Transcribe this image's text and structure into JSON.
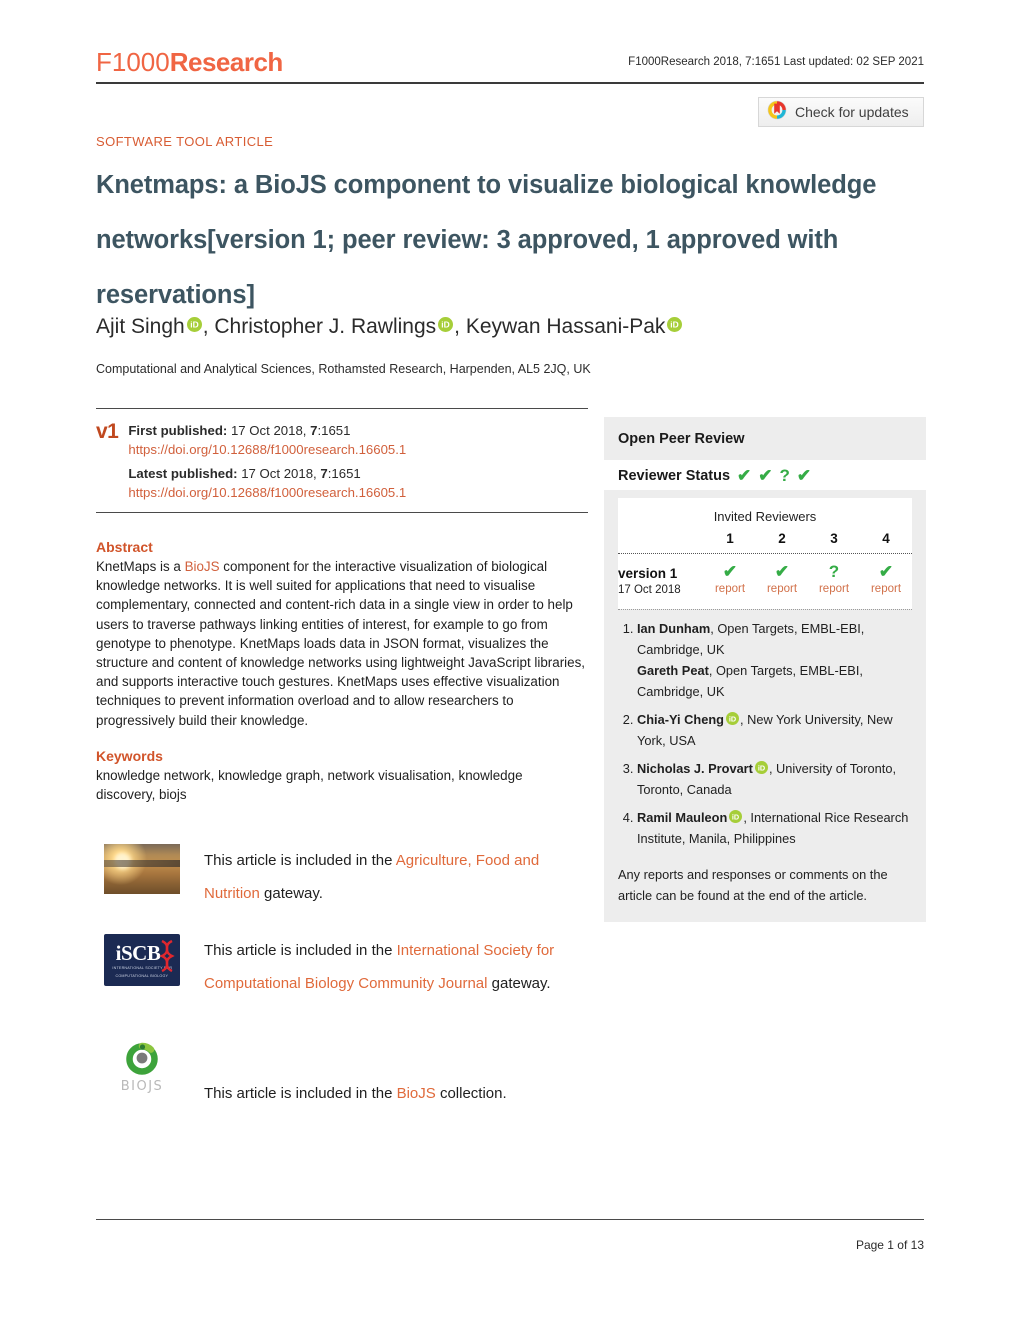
{
  "header": {
    "logo_part1": "F1000",
    "logo_part2": "Research",
    "citation": "F1000Research 2018, 7:1651 Last updated: 02 SEP 2021",
    "crossmark_label": "Check for updates",
    "crossmark_icon": "crossmark-icon"
  },
  "article": {
    "type": "SOFTWARE TOOL ARTICLE",
    "title_main": "Knetmaps: a BioJS component to visualize biological knowledge networks",
    "title_bracket": "[version 1; peer review: 3 approved, 1 approved with reservations]",
    "authors": [
      {
        "name": "Ajit Singh",
        "orcid": true
      },
      {
        "name": "Christopher J. Rawlings",
        "orcid": true
      },
      {
        "name": "Keywan Hassani-Pak",
        "orcid": true
      }
    ],
    "affiliation": "Computational and Analytical Sciences, Rothamsted Research, Harpenden, AL5 2JQ, UK"
  },
  "publication": {
    "version_badge": "v1",
    "first_published_label": "First published:",
    "first_published_date": "17 Oct 2018, ",
    "first_published_vol": "7",
    "first_published_issue": ":1651",
    "first_doi": "https://doi.org/10.12688/f1000research.16605.1",
    "latest_published_label": "Latest published:",
    "latest_published_date": "17 Oct 2018, ",
    "latest_published_vol": "7",
    "latest_published_issue": ":1651",
    "latest_doi": "https://doi.org/10.12688/f1000research.16605.1"
  },
  "abstract": {
    "heading": "Abstract",
    "text_1": "KnetMaps is a ",
    "link": "BioJS",
    "text_2": " component for the interactive visualization of biological knowledge networks. It is well suited for applications that need to visualise complementary, connected and content-rich data in a single view in order to help users to traverse pathways linking entities of interest, for example to go from genotype to phenotype. KnetMaps loads data in JSON format, visualizes the structure and content of knowledge networks using lightweight JavaScript libraries, and supports interactive touch gestures. KnetMaps uses effective visualization techniques to prevent information overload and to allow researchers to progressively build their knowledge."
  },
  "keywords": {
    "heading": "Keywords",
    "text": "knowledge network, knowledge graph, network visualisation, knowledge discovery, biojs"
  },
  "gateways": [
    {
      "icon": "sunset-field-thumbnail",
      "prefix": "This article is included in the ",
      "link": "Agriculture, Food and Nutrition",
      "suffix": " gateway."
    },
    {
      "icon": "iscb-logo",
      "prefix": "This article is included in the ",
      "link": "International Society for Computational Biology Community Journal",
      "suffix": " gateway."
    },
    {
      "icon": "biojs-logo",
      "prefix": "This article is included in the ",
      "link": "BioJS",
      "suffix": " collection."
    }
  ],
  "iscb_logo": {
    "word": "iSCB",
    "subtitle_line1": "INTERNATIONAL SOCIETY FOR",
    "subtitle_line2": "COMPUTATIONAL BIOLOGY"
  },
  "biojs_logo": {
    "word": "BIOJS"
  },
  "peer_review": {
    "panel_title": "Open Peer Review",
    "status_label": "Reviewer Status",
    "status_marks": [
      "check",
      "check",
      "question",
      "check"
    ],
    "invited_reviewers_label": "Invited Reviewers",
    "columns": [
      "1",
      "2",
      "3",
      "4"
    ],
    "version_row": {
      "name": "version 1",
      "date": "17 Oct 2018",
      "cells": [
        {
          "mark": "check",
          "report": "report"
        },
        {
          "mark": "check",
          "report": "report"
        },
        {
          "mark": "question",
          "report": "report"
        },
        {
          "mark": "check",
          "report": "report"
        }
      ]
    },
    "reviewers": [
      {
        "index": "1.",
        "lines": [
          {
            "name": "Ian Dunham",
            "orcid": false,
            "affil": ", Open Targets, EMBL-EBI, Cambridge, UK"
          },
          {
            "name": "Gareth Peat",
            "orcid": false,
            "affil": ", Open Targets, EMBL-EBI, Cambridge, UK"
          }
        ]
      },
      {
        "index": "2.",
        "lines": [
          {
            "name": "Chia-Yi Cheng",
            "orcid": true,
            "affil": ", New York University, New York, USA"
          }
        ]
      },
      {
        "index": "3.",
        "lines": [
          {
            "name": "Nicholas J. Provart",
            "orcid": true,
            "affil": ", University of Toronto, Toronto, Canada"
          }
        ]
      },
      {
        "index": "4.",
        "lines": [
          {
            "name": "Ramil Mauleon",
            "orcid": true,
            "affil": ", International Rice Research Institute, Manila, Philippines"
          }
        ]
      }
    ],
    "note": "Any reports and responses or comments on the article can be found at the end of the article."
  },
  "footer": {
    "page": "Page 1 of 13"
  },
  "colors": {
    "brand_orange": "#f06543",
    "link_orange": "#d1603c",
    "title_slate": "#3d5561",
    "approve_green": "#35ac46",
    "orcid_green": "#a6ce39",
    "panel_bg": "#ededed",
    "iscb_navy": "#1b2a53"
  }
}
